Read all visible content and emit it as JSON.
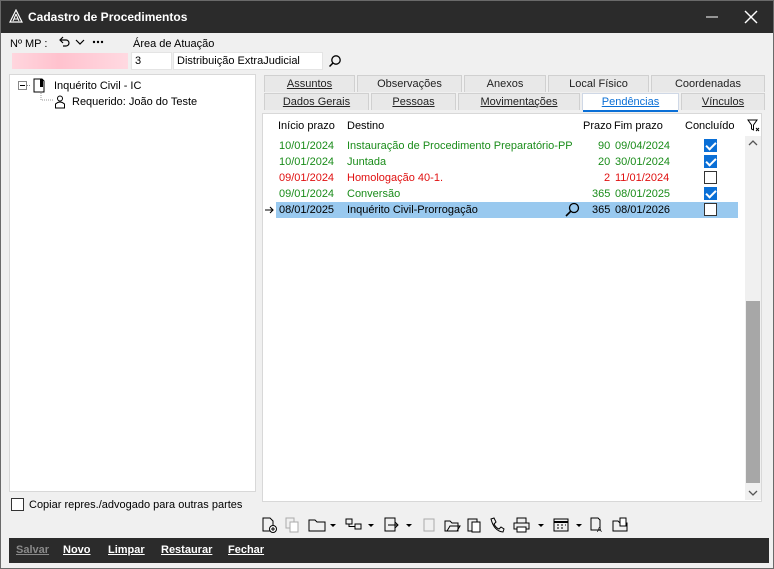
{
  "window": {
    "title": "Cadastro de Procedimentos"
  },
  "form": {
    "mp_label": "Nº MP :",
    "area_label": "Área de Atuação",
    "area_code": "3",
    "area_name": "Distribuição ExtraJudicial"
  },
  "tree": {
    "root_label": "Inquérito Civil - IC",
    "child_label": "Requerido: João do Teste"
  },
  "copy_checkbox_label": "Copiar repres./advogado para outras partes",
  "tabs_row1": [
    "Assuntos",
    "Observações",
    "Anexos",
    "Local Físico",
    "Coordenadas"
  ],
  "tabs_row2": [
    "Dados Gerais",
    "Pessoas",
    "Movimentações",
    "Pendências",
    "Vínculos"
  ],
  "active_tab": "Pendências",
  "grid": {
    "columns": [
      "Início prazo",
      "Destino",
      "Prazo",
      "Fim prazo",
      "Concluído"
    ],
    "rows": [
      {
        "inicio": "10/01/2024",
        "destino": "Instauração de Procedimento Preparatório-PP",
        "prazo": "90",
        "fim": "09/04/2024",
        "concluido": true,
        "color": "green"
      },
      {
        "inicio": "10/01/2024",
        "destino": "Juntada",
        "prazo": "20",
        "fim": "30/01/2024",
        "concluido": true,
        "color": "green"
      },
      {
        "inicio": "09/01/2024",
        "destino": "Homologação 40-1.",
        "prazo": "2",
        "fim": "11/01/2024",
        "concluido": false,
        "color": "red"
      },
      {
        "inicio": "09/01/2024",
        "destino": "Conversão",
        "prazo": "365",
        "fim": "08/01/2025",
        "concluido": true,
        "color": "green"
      },
      {
        "inicio": "08/01/2025",
        "destino": "Inquérito Civil-Prorrogação",
        "prazo": "365",
        "fim": "08/01/2026",
        "concluido": false,
        "color": "black"
      }
    ]
  },
  "actions": {
    "salvar": "Salvar",
    "novo": "Novo",
    "limpar": "Limpar",
    "restaurar": "Restaurar",
    "fechar": "Fechar"
  },
  "colors": {
    "green": "#1a8c1a",
    "red": "#e01010",
    "accent": "#0a6fd6",
    "selected_row": "#99c9ef"
  }
}
